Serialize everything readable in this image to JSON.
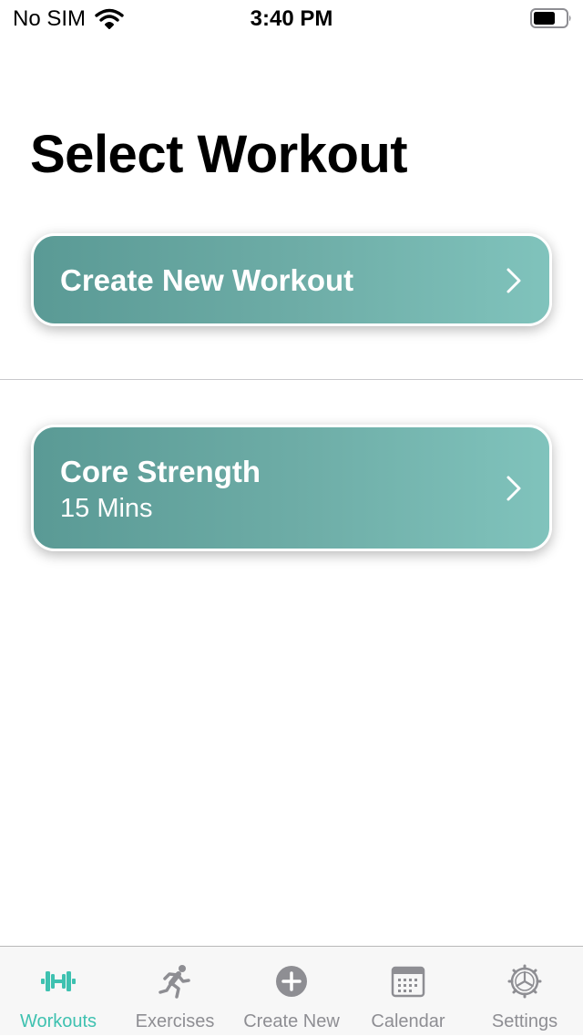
{
  "status_bar": {
    "carrier": "No SIM",
    "time": "3:40 PM"
  },
  "page": {
    "title": "Select Workout"
  },
  "create_card": {
    "title": "Create New Workout"
  },
  "workouts": [
    {
      "title": "Core Strength",
      "duration": "15 Mins"
    }
  ],
  "tab_bar": {
    "tabs": [
      {
        "label": "Workouts",
        "icon": "dumbbell-icon",
        "active": true
      },
      {
        "label": "Exercises",
        "icon": "runner-icon",
        "active": false
      },
      {
        "label": "Create New",
        "icon": "plus-circle-icon",
        "active": false
      },
      {
        "label": "Calendar",
        "icon": "calendar-icon",
        "active": false
      },
      {
        "label": "Settings",
        "icon": "gear-icon",
        "active": false
      }
    ]
  },
  "colors": {
    "accent": "#3ec1b0",
    "card_gradient_start": "#5a9a95",
    "card_gradient_end": "#80c3bc",
    "inactive_tab": "#8e8e93"
  }
}
